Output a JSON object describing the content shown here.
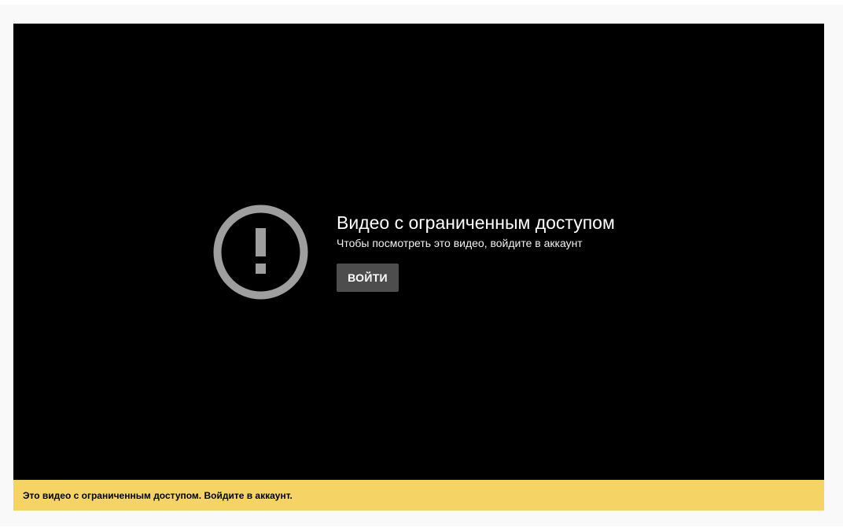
{
  "player": {
    "error_icon": "exclamation-circle-icon",
    "error_title": "Видео с ограниченным доступом",
    "error_subtitle": "Чтобы посмотреть это видео, войдите в аккаунт",
    "signin_label": "ВОЙТИ"
  },
  "notice": {
    "text": "Это видео с ограниченным доступом. Войдите в аккаунт."
  },
  "colors": {
    "player_background": "#000000",
    "icon_gray": "#9e9e9e",
    "button_background": "#4d4d4d",
    "notice_background": "#f5d465",
    "page_background": "#f9f9f9"
  }
}
